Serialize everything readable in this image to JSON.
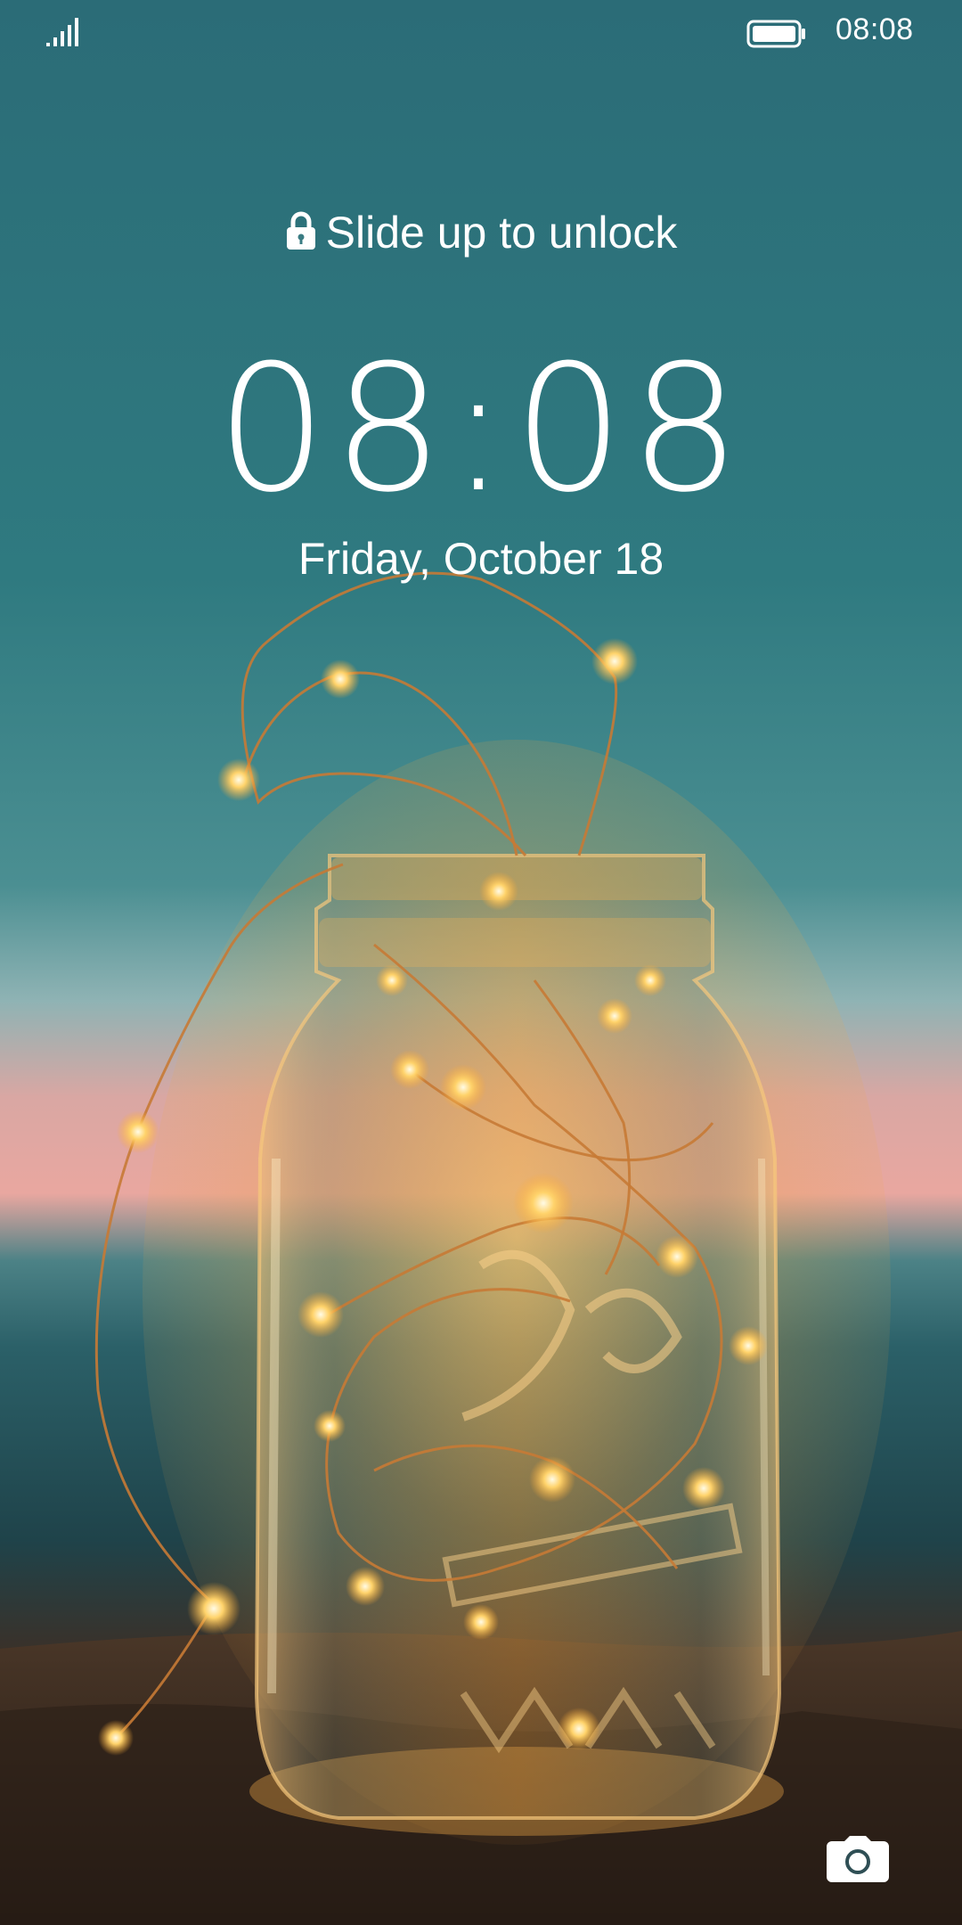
{
  "status_bar": {
    "time": "08:08",
    "signal_icon": "signal-bars-icon",
    "battery_icon": "battery-full-icon"
  },
  "lock_screen": {
    "unlock_hint": "Slide up to unlock",
    "lock_icon": "lock-icon",
    "clock": "08:08",
    "date": "Friday, October 18",
    "camera_icon": "camera-icon"
  },
  "wallpaper": {
    "description_colors": {
      "sky_top": "#2f6f78",
      "sky_mid": "#3f8a8e",
      "horizon_pink": "#e6a3a0",
      "sea": "#245a63",
      "ground": "#3a2a1f",
      "glow": "#ffb347"
    }
  }
}
